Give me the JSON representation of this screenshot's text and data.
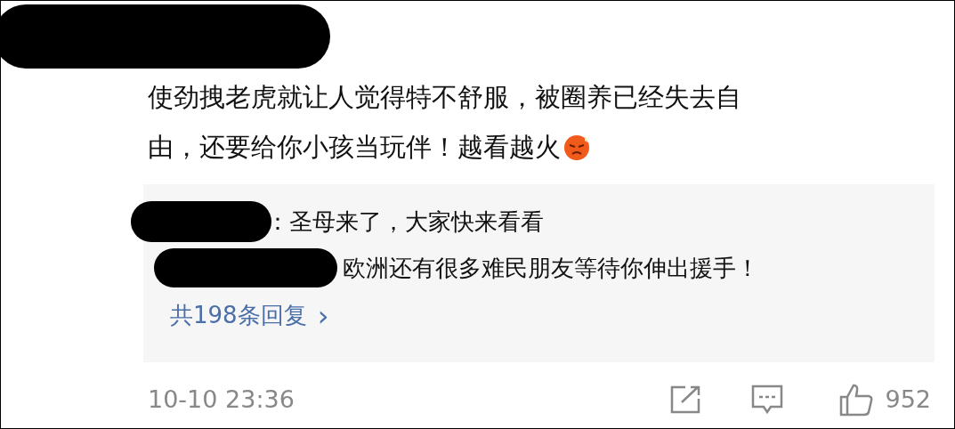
{
  "comment": {
    "lines": [
      "使劲拽老虎就让人觉得特不舒服，被圈养已经失去自",
      "由，还要给你小孩当玩伴！越看越火"
    ]
  },
  "replies": [
    {
      "text": "：圣母来了，大家快来看看"
    },
    {
      "text": "欧洲还有很多难民朋友等待你伸出援手！"
    }
  ],
  "more_replies": {
    "label": "共198条回复",
    "chevron": "›"
  },
  "footer": {
    "time": "10-10 23:36",
    "likes": "952"
  }
}
